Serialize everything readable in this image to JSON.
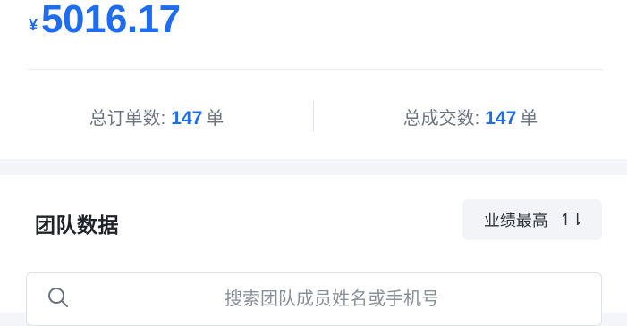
{
  "summary": {
    "currency": "¥",
    "amount": "5016.17",
    "total_orders_label": "总订单数:",
    "total_orders_value": "147",
    "total_orders_unit": "单",
    "total_deals_label": "总成交数:",
    "total_deals_value": "147",
    "total_deals_unit": "单"
  },
  "team": {
    "title": "团队数据",
    "sort_label": "业绩最高",
    "sort_icon": "↿⇂",
    "search_placeholder": "搜索团队成员姓名或手机号"
  },
  "colors": {
    "accent": "#1e6cf2",
    "background": "#f3f5f8"
  }
}
